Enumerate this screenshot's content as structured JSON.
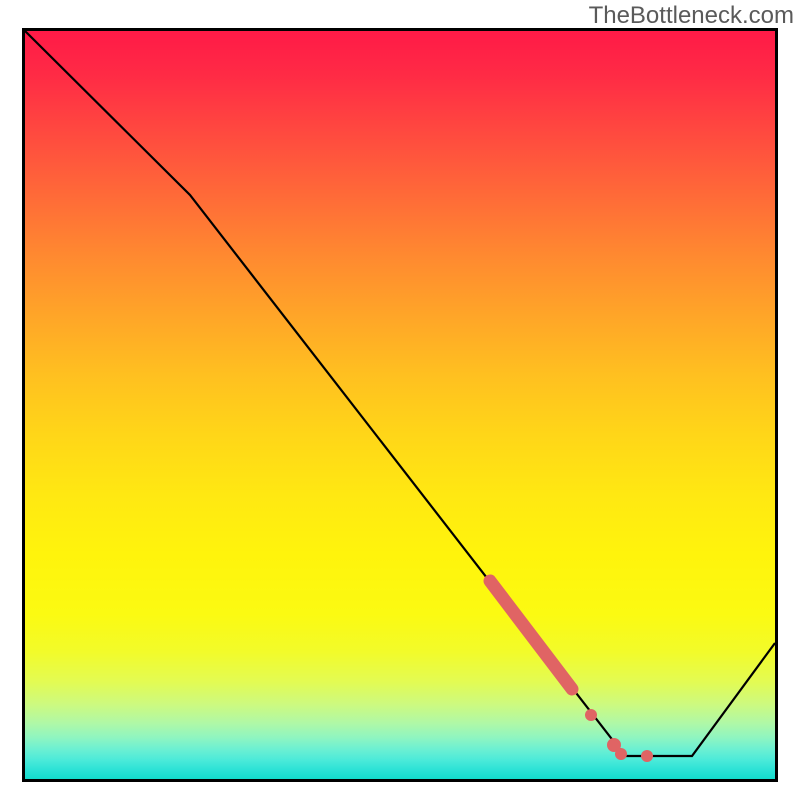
{
  "watermark": "TheBottleneck.com",
  "chart_data": {
    "type": "line",
    "title": "",
    "xlabel": "",
    "ylabel": "",
    "xlim": [
      0,
      100
    ],
    "ylim": [
      0,
      100
    ],
    "series": [
      {
        "name": "bottleneck-curve",
        "points": [
          {
            "x": 0,
            "y": 100
          },
          {
            "x": 22,
            "y": 78
          },
          {
            "x": 80,
            "y": 3
          },
          {
            "x": 89,
            "y": 3
          },
          {
            "x": 100,
            "y": 18
          }
        ]
      }
    ],
    "highlights": [
      {
        "name": "highlight-segment",
        "type": "thick-line",
        "x1": 62,
        "y1": 26.5,
        "x2": 73,
        "y2": 12,
        "width": 10
      },
      {
        "name": "dot-1",
        "type": "dot",
        "x": 75.5,
        "y": 8.5,
        "r": 5
      },
      {
        "name": "dot-2",
        "type": "dot",
        "x": 78.5,
        "y": 4.5,
        "r": 6
      },
      {
        "name": "dot-3",
        "type": "dot",
        "x": 79.5,
        "y": 3.3,
        "r": 5
      },
      {
        "name": "dot-4",
        "type": "dot",
        "x": 83,
        "y": 3,
        "r": 5
      }
    ],
    "gradient_colors": {
      "top": "#ff1a47",
      "mid_upper": "#ffa528",
      "mid": "#ffe812",
      "mid_lower": "#cdfa7f",
      "bottom": "#13dccc"
    },
    "highlight_color": "#e06464"
  }
}
